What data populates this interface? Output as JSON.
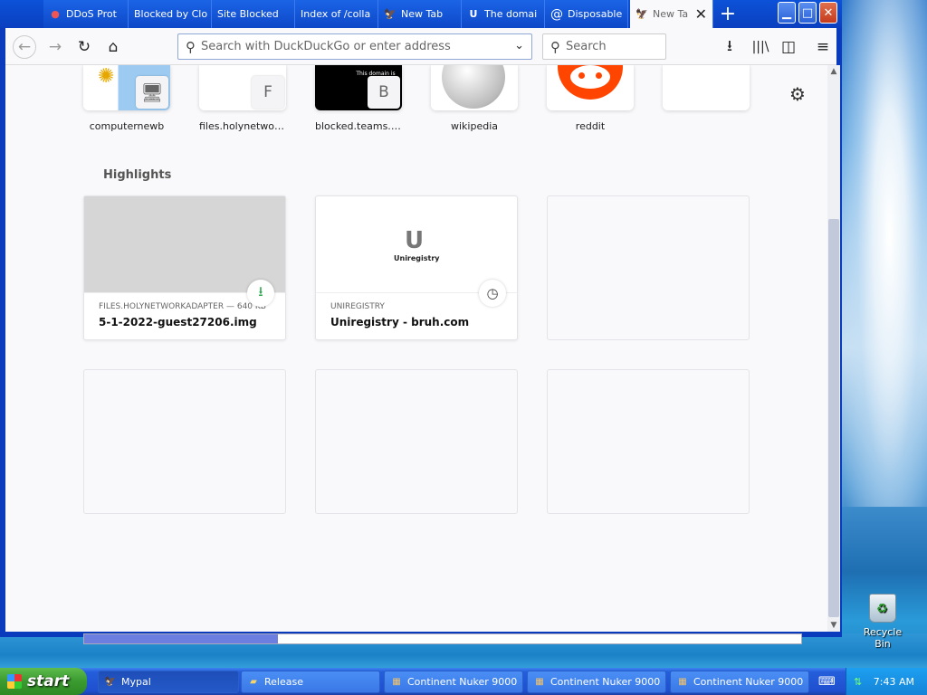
{
  "tabs": [
    {
      "label": "DDoS Prot",
      "icon": "ddos-icon"
    },
    {
      "label": "Blocked by Clo",
      "icon": "none"
    },
    {
      "label": "Site Blocked",
      "icon": "none"
    },
    {
      "label": "Index of /colla",
      "icon": "none"
    },
    {
      "label": "New Tab",
      "icon": "mypal-icon"
    },
    {
      "label": "The domai",
      "icon": "uniregistry-icon"
    },
    {
      "label": "Disposable",
      "icon": "at-icon"
    },
    {
      "label": "New Ta",
      "icon": "mypal-icon"
    }
  ],
  "toolbar": {
    "url_placeholder": "Search with DuckDuckGo or enter address",
    "search_placeholder": "Search"
  },
  "top_sites": [
    {
      "name": "computernewb"
    },
    {
      "name": "files.holynetwork...",
      "badge": "F"
    },
    {
      "name": "blocked.teams.clo...",
      "badge": "B",
      "preview_text": "This domain is block"
    },
    {
      "name": "wikipedia"
    },
    {
      "name": "reddit"
    },
    {
      "name": ""
    }
  ],
  "highlights": {
    "title": "Highlights",
    "cards": [
      {
        "source": "FILES.HOLYNETWORKADAPTER — 640 KB",
        "title": "5-1-2022-guest27206.img",
        "type": "download"
      },
      {
        "source": "UNIREGISTRY",
        "title": "Uniregistry - bruh.com",
        "type": "history",
        "logo_text": "Uniregistry"
      }
    ]
  },
  "taskbar": {
    "start_label": "start",
    "items": [
      {
        "label": "Mypal",
        "active": true
      },
      {
        "label": "Release"
      },
      {
        "label": "Continent Nuker 9000"
      },
      {
        "label": "Continent Nuker 9000"
      },
      {
        "label": "Continent Nuker 9000"
      }
    ],
    "clock": "7:43 AM"
  },
  "desktop": {
    "recycle_bin_label": "Recycle Bin"
  },
  "colors": {
    "accent": "#0c52d8",
    "download_green": "#2ba84a",
    "reddit": "#ff4500"
  },
  "scroll_fraction": 0.27
}
